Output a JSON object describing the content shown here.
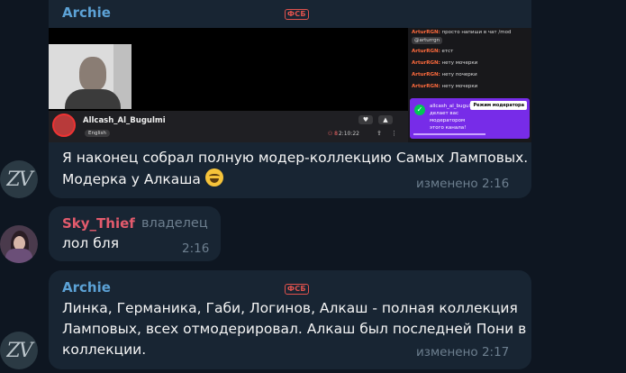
{
  "colors": {
    "background": "#0e1621",
    "bubble": "#182533",
    "archie_name": "#5ca2d6",
    "sky_thief_name": "#e35b6d",
    "admin_badge": "#e0524d",
    "meta": "#6d7f8f"
  },
  "messages": [
    {
      "author": "Archie",
      "badge": "ФСБ",
      "text_line1": "Я наконец собрал полную модер-коллекцию Самых Ламповых.",
      "text_line2": "Модерка у Алкаша",
      "emoji": "grinning-squinting-face",
      "meta": "изменено 2:16",
      "avatar_text": "ZV",
      "embedded_screenshot": {
        "channel_name": "Allcash_Al_Bugulmi",
        "tag": "English",
        "viewers": "8",
        "uptime": "2:10:22",
        "chat": [
          {
            "user": "ArturRGN:",
            "text": "просто напиши в чат /mod"
          },
          {
            "mention": "@arturrgn"
          },
          {
            "user": "ArturRGN:",
            "text": "етст"
          },
          {
            "user": "ArturRGN:",
            "text": "нету мочерки"
          },
          {
            "user": "ArturRGN:",
            "text": "нету почерки"
          },
          {
            "user": "ArturRGN:",
            "text": "нету мочерки"
          }
        ],
        "mod_notice": {
          "user": "allcash_al_bugulmi",
          "text": "делает вас модератором этого канала!",
          "button": "Режим модератора"
        }
      }
    },
    {
      "author": "Sky_Thief",
      "role": "владелец",
      "text": "лол бля",
      "time": "2:16"
    },
    {
      "author": "Archie",
      "badge": "ФСБ",
      "text_line1": "Линка, Германика, Габи, Логинов, Алкаш - полная коллекция",
      "text_line2": "Ламповых, всех отмодерировал. Алкаш был последней Пони в",
      "text_line3": "коллекции.",
      "meta": "изменено 2:17",
      "avatar_text": "ZV"
    }
  ]
}
